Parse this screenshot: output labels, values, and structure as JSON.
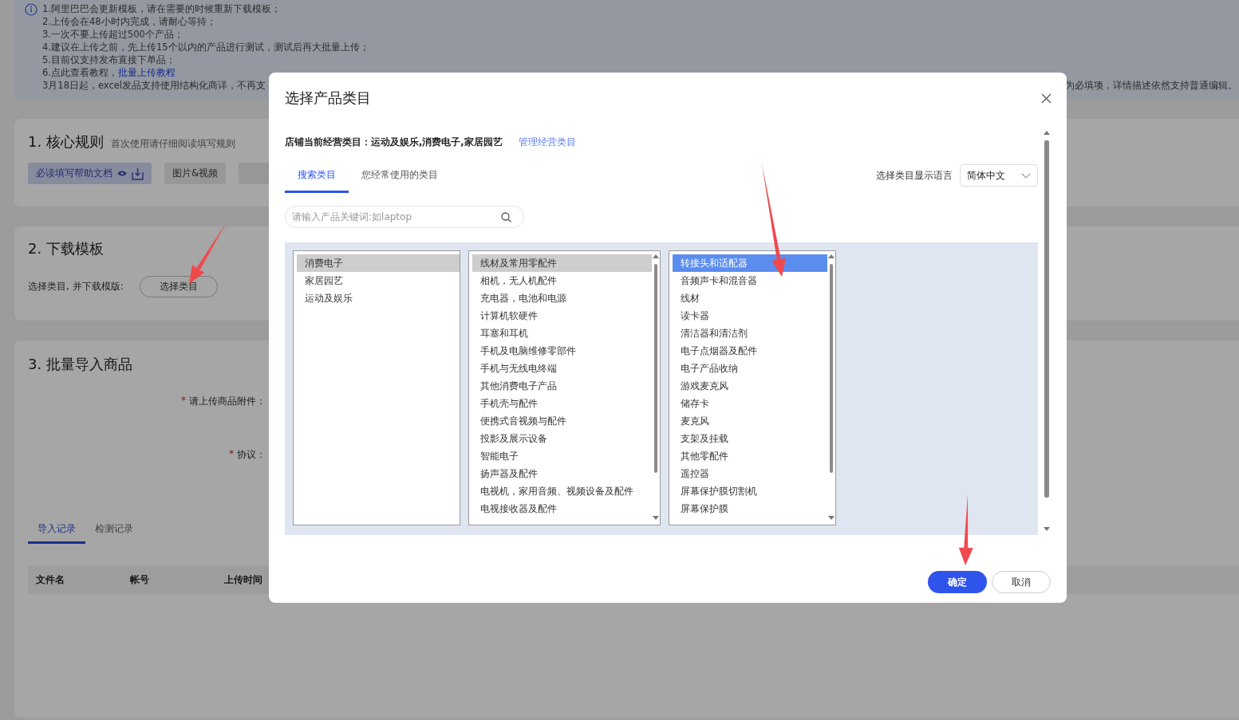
{
  "notice": {
    "lines": [
      {
        "text": "1.阿里巴巴会更新模板，请在需要的时候重新下载模板；"
      },
      {
        "text": "2.上传会在48小时内完成，请耐心等待；"
      },
      {
        "text": "3.一次不要上传超过500个产品；"
      },
      {
        "text": "4.建议在上传之前，先上传15个以内的产品进行测试，测试后再大批量上传；"
      },
      {
        "text": "5.目前仅支持发布直接下单品；"
      },
      {
        "text": "6.点此查看教程，",
        "link": "批量上传教程"
      }
    ],
    "last_line_left": "3月18日起，excel发品支持使用结构化商详，不再支",
    "last_line_right": "为必填项，详情描述依然支持普通编辑。"
  },
  "core_rules": {
    "title": "1. 核心规则",
    "subtitle": "首次使用请仔细阅读填写规则",
    "buttons": [
      {
        "label": "必读填写帮助文档",
        "kind": "doc"
      },
      {
        "label": "图片&视频",
        "kind": "plain"
      },
      {
        "kind": "cut"
      }
    ]
  },
  "download_template": {
    "title": "2. 下载模板",
    "label": "选择类目, 并下载模版:",
    "button": "选择类目"
  },
  "bulk_import": {
    "title": "3. 批量导入商品",
    "fields": [
      {
        "mark": "*",
        "label": "请上传商品附件："
      },
      {
        "mark": "*",
        "label": "协议："
      }
    ],
    "tabs": [
      {
        "label": "导入记录",
        "selected": true
      },
      {
        "label": "检测记录",
        "selected": false
      }
    ],
    "table": {
      "columns": [
        "文件名",
        "帐号",
        "上传时间"
      ]
    }
  },
  "modal": {
    "title": "选择产品类目",
    "store_categories": "店铺当前经营类目：运动及娱乐,消费电子,家居园艺",
    "manage_link": "管理经营类目",
    "tabs": [
      {
        "label": "搜索类目",
        "selected": true
      },
      {
        "label": "您经常使用的类目",
        "selected": false
      }
    ],
    "language_label": "选择类目显示语言",
    "language": "简体中文",
    "search": {
      "placeholder": "请输入产品关键词:如laptop"
    },
    "lists": [
      {
        "scrollable": false,
        "items": [
          {
            "label": "消费电子",
            "selected": true
          },
          {
            "label": "家居园艺",
            "selected": false
          },
          {
            "label": "运动及娱乐",
            "selected": false
          }
        ]
      },
      {
        "scrollable": true,
        "items": [
          {
            "label": "线材及常用零配件",
            "selected": true
          },
          {
            "label": "相机，无人机配件",
            "selected": false
          },
          {
            "label": "充电器，电池和电源",
            "selected": false
          },
          {
            "label": "计算机软硬件",
            "selected": false
          },
          {
            "label": "耳塞和耳机",
            "selected": false
          },
          {
            "label": "手机及电脑维修零部件",
            "selected": false
          },
          {
            "label": "手机与无线电终端",
            "selected": false
          },
          {
            "label": "其他消费电子产品",
            "selected": false
          },
          {
            "label": "手机壳与配件",
            "selected": false
          },
          {
            "label": "便携式音视频与配件",
            "selected": false
          },
          {
            "label": "投影及展示设备",
            "selected": false
          },
          {
            "label": "智能电子",
            "selected": false
          },
          {
            "label": "扬声器及配件",
            "selected": false
          },
          {
            "label": "电视机，家用音频、视频设备及配件",
            "selected": false
          },
          {
            "label": "电视接收器及配件",
            "selected": false
          }
        ]
      },
      {
        "scrollable": true,
        "items": [
          {
            "label": "转接头和适配器",
            "selected": true
          },
          {
            "label": "音频声卡和混音器",
            "selected": false
          },
          {
            "label": "线材",
            "selected": false
          },
          {
            "label": "读卡器",
            "selected": false
          },
          {
            "label": "清洁器和清洁剂",
            "selected": false
          },
          {
            "label": "电子点烟器及配件",
            "selected": false
          },
          {
            "label": "电子产品收纳",
            "selected": false
          },
          {
            "label": "游戏麦克风",
            "selected": false
          },
          {
            "label": "储存卡",
            "selected": false
          },
          {
            "label": "麦克风",
            "selected": false
          },
          {
            "label": "支架及挂载",
            "selected": false
          },
          {
            "label": "其他零配件",
            "selected": false
          },
          {
            "label": "遥控器",
            "selected": false
          },
          {
            "label": "屏幕保护膜切割机",
            "selected": false
          },
          {
            "label": "屏幕保护膜",
            "selected": false
          }
        ]
      }
    ],
    "buttons": [
      {
        "label": "确定",
        "kind": "primary"
      },
      {
        "label": "取消",
        "kind": "secondary"
      }
    ]
  }
}
